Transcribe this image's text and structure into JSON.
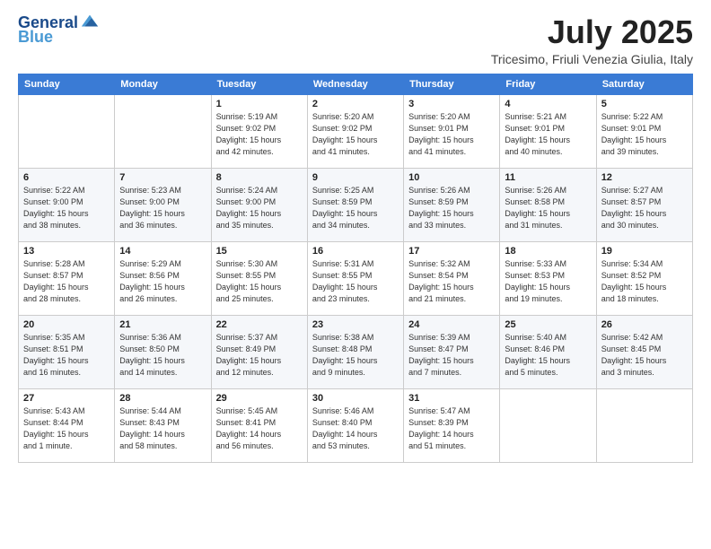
{
  "logo": {
    "line1": "General",
    "line2": "Blue"
  },
  "header": {
    "month": "July 2025",
    "location": "Tricesimo, Friuli Venezia Giulia, Italy"
  },
  "days_of_week": [
    "Sunday",
    "Monday",
    "Tuesday",
    "Wednesday",
    "Thursday",
    "Friday",
    "Saturday"
  ],
  "weeks": [
    [
      {
        "day": "",
        "info": ""
      },
      {
        "day": "",
        "info": ""
      },
      {
        "day": "1",
        "info": "Sunrise: 5:19 AM\nSunset: 9:02 PM\nDaylight: 15 hours\nand 42 minutes."
      },
      {
        "day": "2",
        "info": "Sunrise: 5:20 AM\nSunset: 9:02 PM\nDaylight: 15 hours\nand 41 minutes."
      },
      {
        "day": "3",
        "info": "Sunrise: 5:20 AM\nSunset: 9:01 PM\nDaylight: 15 hours\nand 41 minutes."
      },
      {
        "day": "4",
        "info": "Sunrise: 5:21 AM\nSunset: 9:01 PM\nDaylight: 15 hours\nand 40 minutes."
      },
      {
        "day": "5",
        "info": "Sunrise: 5:22 AM\nSunset: 9:01 PM\nDaylight: 15 hours\nand 39 minutes."
      }
    ],
    [
      {
        "day": "6",
        "info": "Sunrise: 5:22 AM\nSunset: 9:00 PM\nDaylight: 15 hours\nand 38 minutes."
      },
      {
        "day": "7",
        "info": "Sunrise: 5:23 AM\nSunset: 9:00 PM\nDaylight: 15 hours\nand 36 minutes."
      },
      {
        "day": "8",
        "info": "Sunrise: 5:24 AM\nSunset: 9:00 PM\nDaylight: 15 hours\nand 35 minutes."
      },
      {
        "day": "9",
        "info": "Sunrise: 5:25 AM\nSunset: 8:59 PM\nDaylight: 15 hours\nand 34 minutes."
      },
      {
        "day": "10",
        "info": "Sunrise: 5:26 AM\nSunset: 8:59 PM\nDaylight: 15 hours\nand 33 minutes."
      },
      {
        "day": "11",
        "info": "Sunrise: 5:26 AM\nSunset: 8:58 PM\nDaylight: 15 hours\nand 31 minutes."
      },
      {
        "day": "12",
        "info": "Sunrise: 5:27 AM\nSunset: 8:57 PM\nDaylight: 15 hours\nand 30 minutes."
      }
    ],
    [
      {
        "day": "13",
        "info": "Sunrise: 5:28 AM\nSunset: 8:57 PM\nDaylight: 15 hours\nand 28 minutes."
      },
      {
        "day": "14",
        "info": "Sunrise: 5:29 AM\nSunset: 8:56 PM\nDaylight: 15 hours\nand 26 minutes."
      },
      {
        "day": "15",
        "info": "Sunrise: 5:30 AM\nSunset: 8:55 PM\nDaylight: 15 hours\nand 25 minutes."
      },
      {
        "day": "16",
        "info": "Sunrise: 5:31 AM\nSunset: 8:55 PM\nDaylight: 15 hours\nand 23 minutes."
      },
      {
        "day": "17",
        "info": "Sunrise: 5:32 AM\nSunset: 8:54 PM\nDaylight: 15 hours\nand 21 minutes."
      },
      {
        "day": "18",
        "info": "Sunrise: 5:33 AM\nSunset: 8:53 PM\nDaylight: 15 hours\nand 19 minutes."
      },
      {
        "day": "19",
        "info": "Sunrise: 5:34 AM\nSunset: 8:52 PM\nDaylight: 15 hours\nand 18 minutes."
      }
    ],
    [
      {
        "day": "20",
        "info": "Sunrise: 5:35 AM\nSunset: 8:51 PM\nDaylight: 15 hours\nand 16 minutes."
      },
      {
        "day": "21",
        "info": "Sunrise: 5:36 AM\nSunset: 8:50 PM\nDaylight: 15 hours\nand 14 minutes."
      },
      {
        "day": "22",
        "info": "Sunrise: 5:37 AM\nSunset: 8:49 PM\nDaylight: 15 hours\nand 12 minutes."
      },
      {
        "day": "23",
        "info": "Sunrise: 5:38 AM\nSunset: 8:48 PM\nDaylight: 15 hours\nand 9 minutes."
      },
      {
        "day": "24",
        "info": "Sunrise: 5:39 AM\nSunset: 8:47 PM\nDaylight: 15 hours\nand 7 minutes."
      },
      {
        "day": "25",
        "info": "Sunrise: 5:40 AM\nSunset: 8:46 PM\nDaylight: 15 hours\nand 5 minutes."
      },
      {
        "day": "26",
        "info": "Sunrise: 5:42 AM\nSunset: 8:45 PM\nDaylight: 15 hours\nand 3 minutes."
      }
    ],
    [
      {
        "day": "27",
        "info": "Sunrise: 5:43 AM\nSunset: 8:44 PM\nDaylight: 15 hours\nand 1 minute."
      },
      {
        "day": "28",
        "info": "Sunrise: 5:44 AM\nSunset: 8:43 PM\nDaylight: 14 hours\nand 58 minutes."
      },
      {
        "day": "29",
        "info": "Sunrise: 5:45 AM\nSunset: 8:41 PM\nDaylight: 14 hours\nand 56 minutes."
      },
      {
        "day": "30",
        "info": "Sunrise: 5:46 AM\nSunset: 8:40 PM\nDaylight: 14 hours\nand 53 minutes."
      },
      {
        "day": "31",
        "info": "Sunrise: 5:47 AM\nSunset: 8:39 PM\nDaylight: 14 hours\nand 51 minutes."
      },
      {
        "day": "",
        "info": ""
      },
      {
        "day": "",
        "info": ""
      }
    ]
  ]
}
